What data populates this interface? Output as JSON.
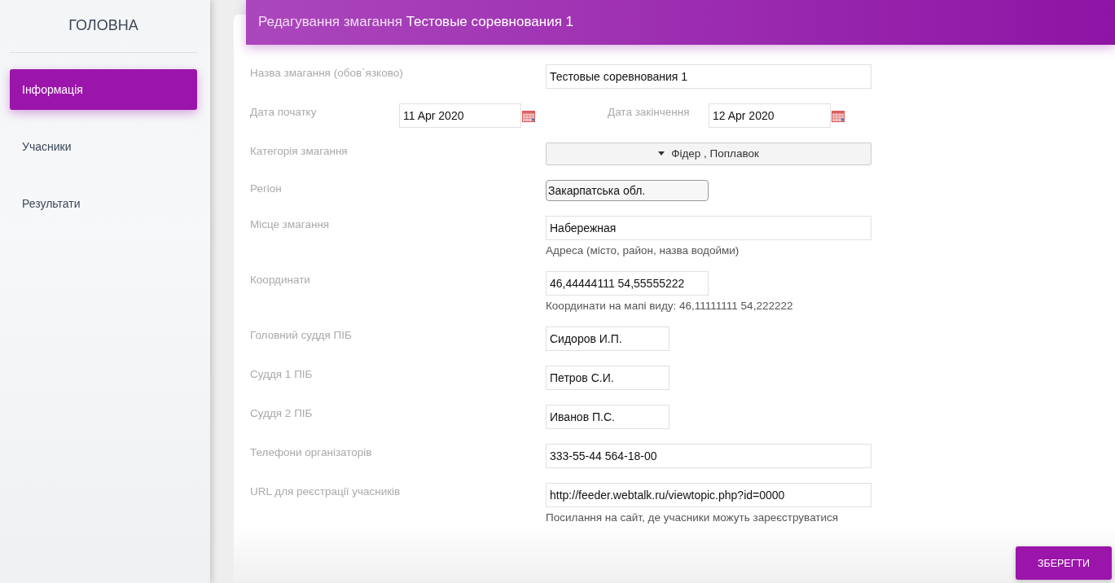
{
  "sidebar": {
    "title": "ГОЛОВНА",
    "items": [
      {
        "label": "Інформація",
        "selected": true
      },
      {
        "label": "Учасники",
        "selected": false
      },
      {
        "label": "Результати",
        "selected": false
      }
    ]
  },
  "header": {
    "title": "Редагування змагання **Тестовые соревнования 1**"
  },
  "form": {
    "fields": [
      {
        "kind": "text",
        "label": "Назва змагання (обов`язково)",
        "value": "Тестовые соревнования 1"
      },
      {
        "kind": "dates",
        "label": "Дата початку",
        "value": "11 Apr 2020",
        "label_2": "Дата закінчення",
        "value_2": "12 Apr 2020"
      },
      {
        "kind": "dropdown",
        "label": "Категорія змагання",
        "value": "Фідер , Поплавок"
      },
      {
        "kind": "select",
        "label": "Регіон",
        "value": "Закарпатська обл."
      },
      {
        "kind": "text",
        "label": "Місце змагання",
        "value": "Набережная",
        "hint": "Адреса (місто, район, назва водойми)"
      },
      {
        "kind": "medium-text",
        "label": "Координати",
        "value": "46,44444111 54,55555222",
        "hint": "Координати на мапі виду: 46,11111111 54,222222"
      },
      {
        "kind": "short-text",
        "label": "Головний суддя ПІБ",
        "value": "Сидоров И.П."
      },
      {
        "kind": "short-text",
        "label": "Суддя 1 ПІБ",
        "value": "Петров С.И."
      },
      {
        "kind": "short-text",
        "label": "Суддя 2 ПІБ",
        "value": "Иванов П.С."
      },
      {
        "kind": "text",
        "label": "Телефони організаторів",
        "value": "333-55-44 564-18-00"
      },
      {
        "kind": "text",
        "label": "URL для реєстрації учасників",
        "value": "http://feeder.webtalk.ru/viewtopic.php?id=0000",
        "hint": "Посилання на сайт, де учасники можуть зареєструватися"
      }
    ],
    "save_button": "ЗБЕРЕГТИ"
  }
}
